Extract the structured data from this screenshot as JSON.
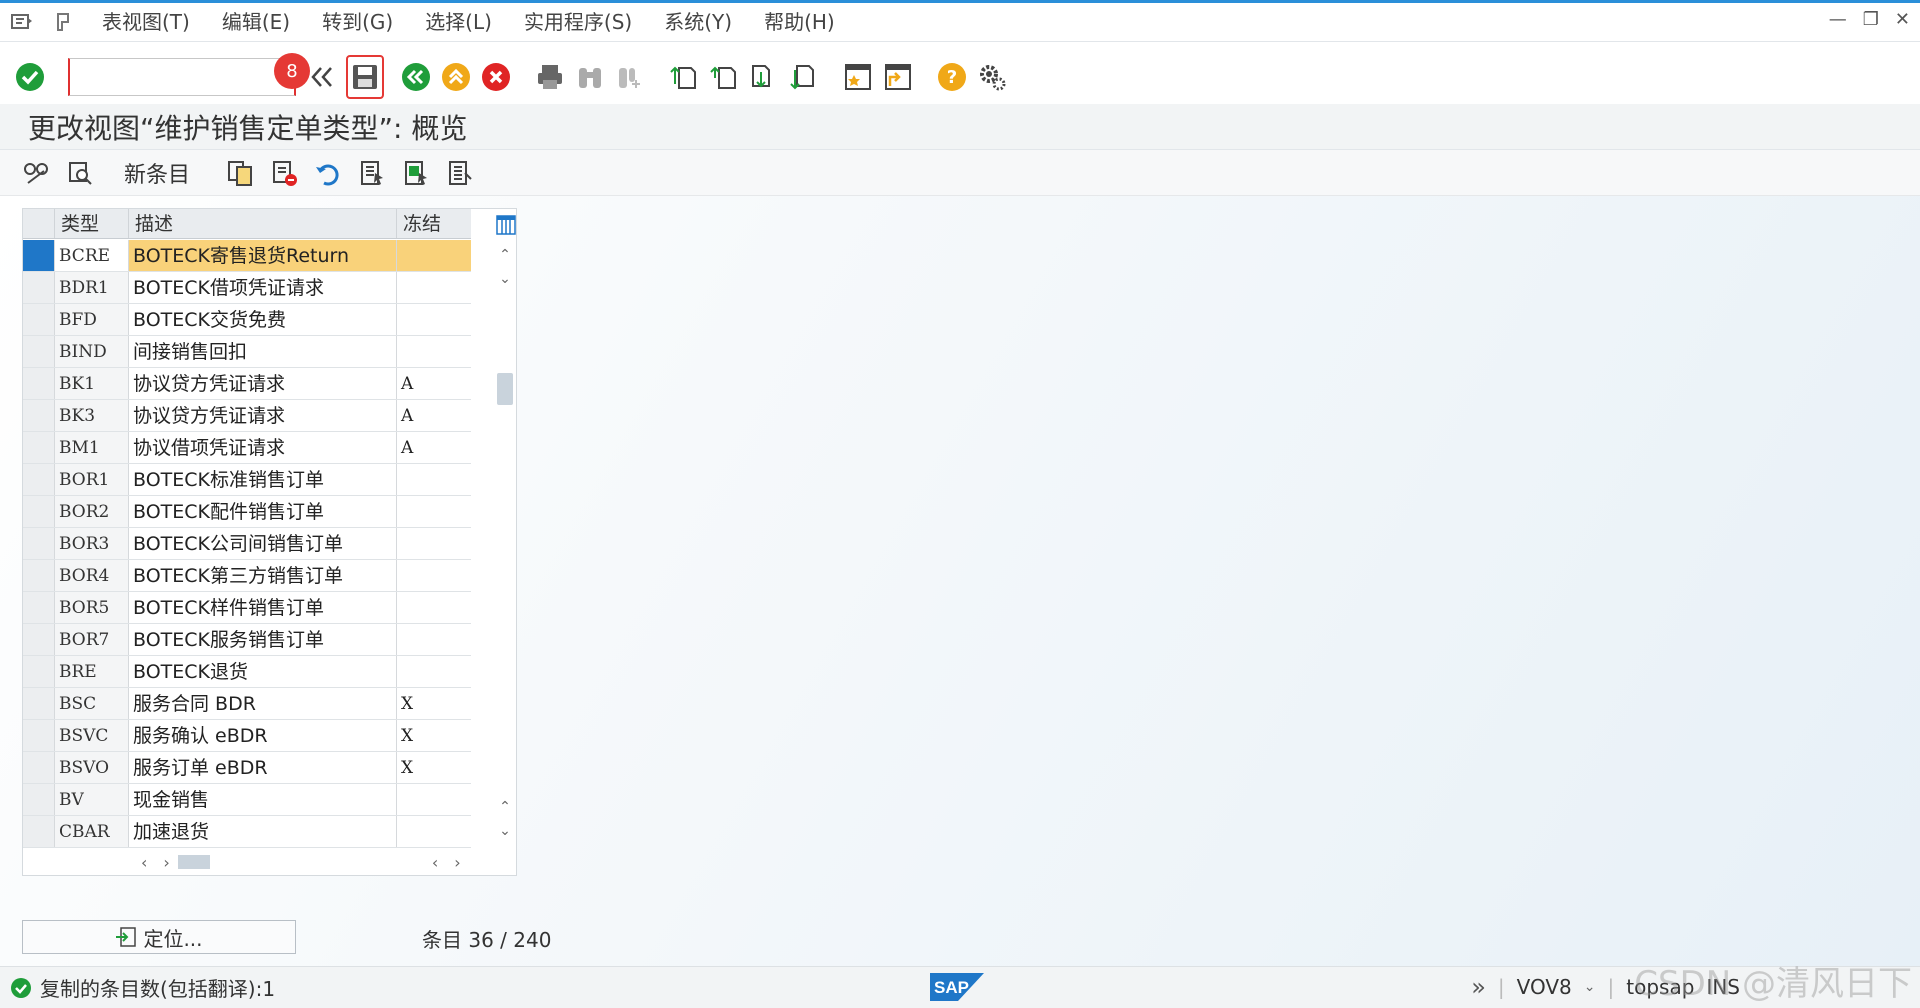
{
  "menu": {
    "items": [
      "表视图(T)",
      "编辑(E)",
      "转到(G)",
      "选择(L)",
      "实用程序(S)",
      "系统(Y)",
      "帮助(H)"
    ]
  },
  "toolbar": {
    "command_value": "",
    "badge": "8"
  },
  "title": "更改视图“维护销售定单类型”: 概览",
  "apptoolbar": {
    "new_entries": "新条目"
  },
  "table": {
    "headers": [
      "类型",
      "描述",
      "冻结"
    ],
    "rows": [
      {
        "type": "BCRE",
        "desc": "BOTECK寄售退货Return",
        "frz": ""
      },
      {
        "type": "BDR1",
        "desc": "BOTECK借项凭证请求",
        "frz": ""
      },
      {
        "type": "BFD",
        "desc": "BOTECK交货免费",
        "frz": ""
      },
      {
        "type": "BIND",
        "desc": "间接销售回扣",
        "frz": ""
      },
      {
        "type": "BK1",
        "desc": "协议贷方凭证请求",
        "frz": "A"
      },
      {
        "type": "BK3",
        "desc": "协议贷方凭证请求",
        "frz": "A"
      },
      {
        "type": "BM1",
        "desc": "协议借项凭证请求",
        "frz": "A"
      },
      {
        "type": "BOR1",
        "desc": "BOTECK标准销售订单",
        "frz": ""
      },
      {
        "type": "BOR2",
        "desc": "BOTECK配件销售订单",
        "frz": ""
      },
      {
        "type": "BOR3",
        "desc": "BOTECK公司间销售订单",
        "frz": ""
      },
      {
        "type": "BOR4",
        "desc": "BOTECK第三方销售订单",
        "frz": ""
      },
      {
        "type": "BOR5",
        "desc": "BOTECK样件销售订单",
        "frz": ""
      },
      {
        "type": "BOR7",
        "desc": "BOTECK服务销售订单",
        "frz": ""
      },
      {
        "type": "BRE",
        "desc": "BOTECK退货",
        "frz": ""
      },
      {
        "type": "BSC",
        "desc": "服务合同 BDR",
        "frz": "X"
      },
      {
        "type": "BSVC",
        "desc": "服务确认 eBDR",
        "frz": "X"
      },
      {
        "type": "BSVO",
        "desc": "服务订单 eBDR",
        "frz": "X"
      },
      {
        "type": "BV",
        "desc": "现金销售",
        "frz": ""
      },
      {
        "type": "CBAR",
        "desc": "加速退货",
        "frz": ""
      }
    ]
  },
  "position_button": "定位...",
  "entries": "条目 36 / 240",
  "status": {
    "message": "复制的条目数(包括翻译):1",
    "transaction": "VOV8",
    "server": "topsap",
    "mode": "INS",
    "sap": "SAP"
  },
  "watermark": "CSDN @清风日下",
  "colors": {
    "accent": "#2a8fd9",
    "selected_row": "#f9d27a",
    "selected_marker": "#1f77c8",
    "badge": "#e53935"
  }
}
